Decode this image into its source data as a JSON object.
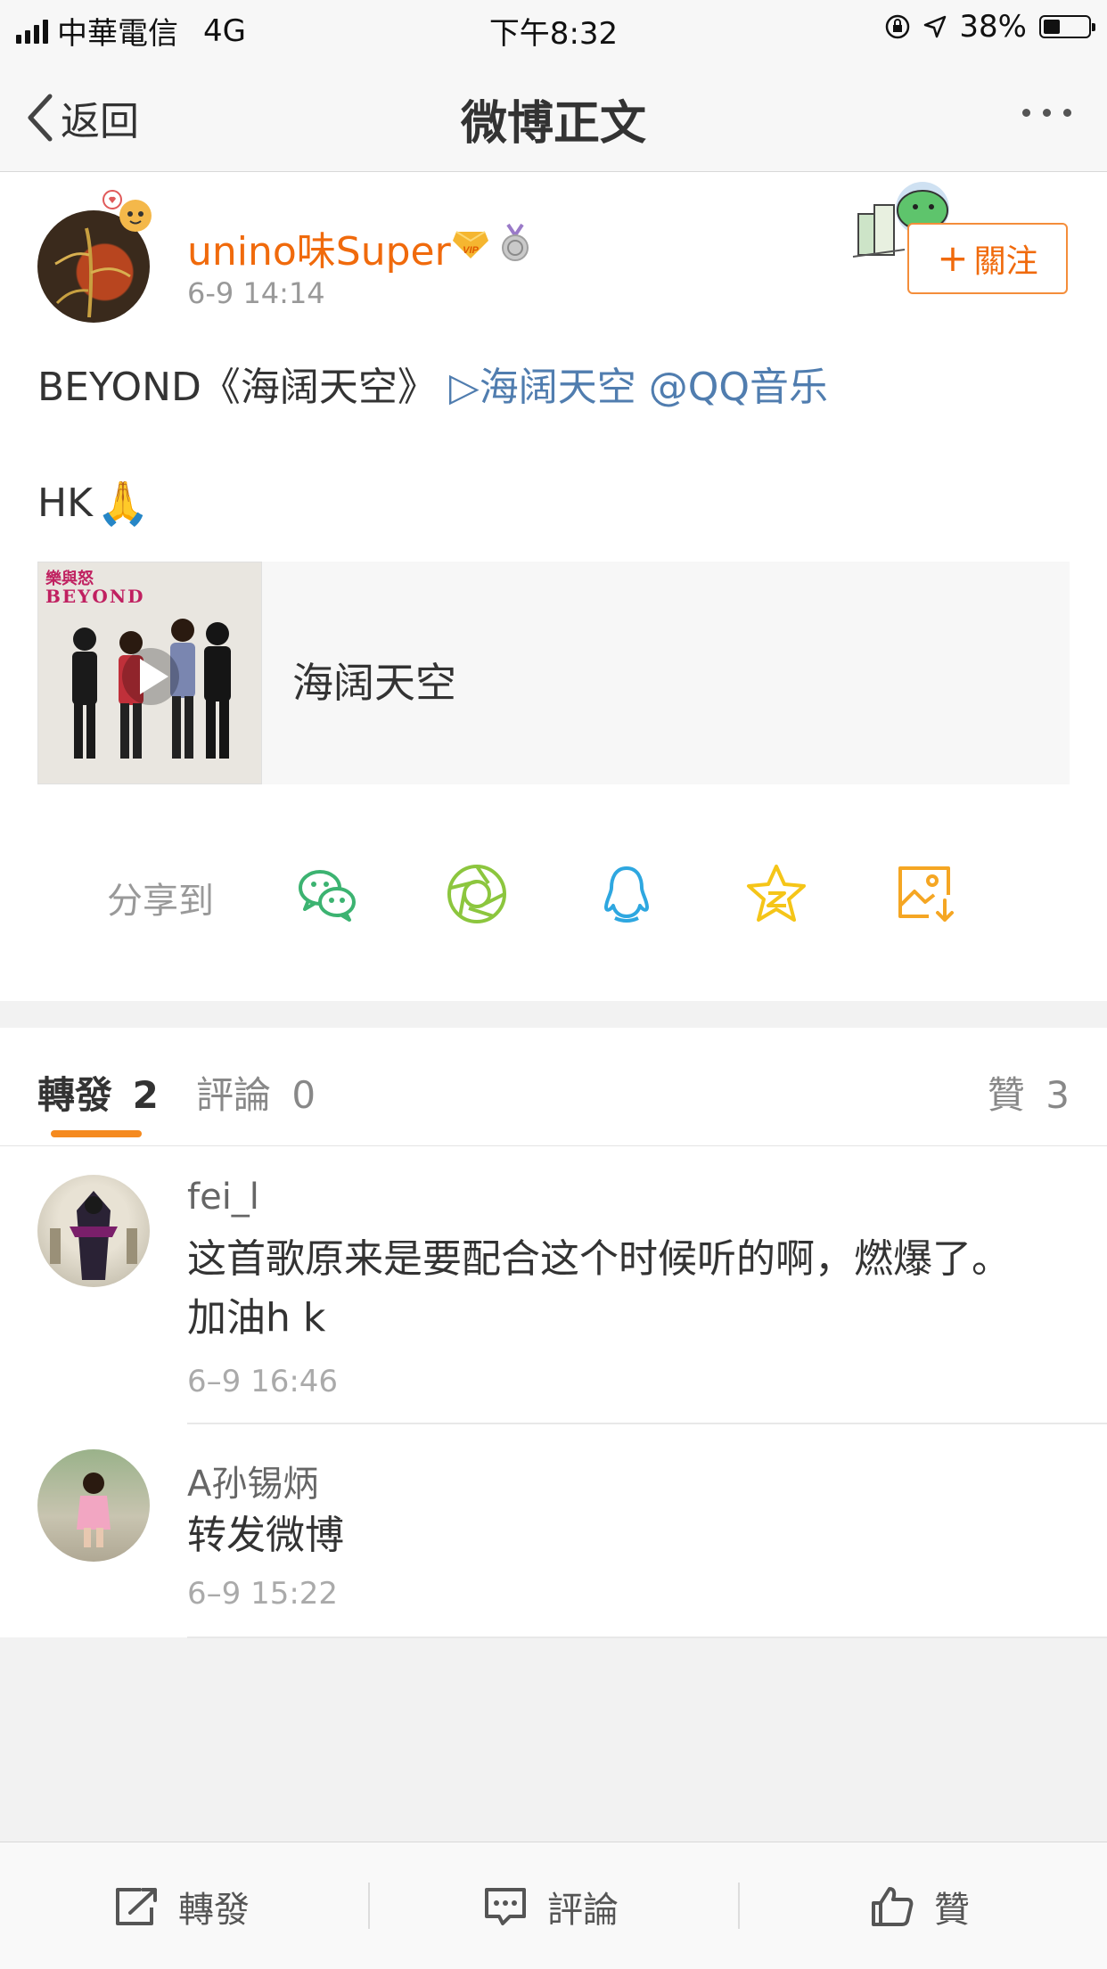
{
  "status_bar": {
    "carrier": "中華電信",
    "network": "4G",
    "time": "下午8:32",
    "battery": "38%"
  },
  "nav": {
    "back_label": "返回",
    "title": "微博正文"
  },
  "post": {
    "username": "unino味Super",
    "time": "6-9 14:14",
    "follow_label": "關注",
    "text_prefix": "BEYOND《海阔天空》 ",
    "text_link": "▷海阔天空 @QQ音乐",
    "text_line2": "HK",
    "emoji": "🙏",
    "music_card": {
      "title": "海阔天空",
      "album_art_text1": "樂與怒",
      "album_art_text2": "BEYOND"
    },
    "share_label": "分享到",
    "share_targets": [
      "wechat-icon",
      "moments-icon",
      "qq-icon",
      "qzone-icon",
      "save-image-icon"
    ]
  },
  "tabs": {
    "repost_label": "轉發",
    "repost_count": "2",
    "comment_label": "評論",
    "comment_count": "0",
    "like_label": "贊",
    "like_count": "3"
  },
  "comments": [
    {
      "name": "fei_l",
      "text_line1": "这首歌原来是要配合这个时候听的啊，燃爆了。",
      "text_line2": "加油h k",
      "time": "6–9 16:46"
    },
    {
      "name": "A孙锡炳",
      "text_line1": "转发微博",
      "time": "6–9 15:22"
    }
  ],
  "toolbar": {
    "repost_label": "轉發",
    "comment_label": "評論",
    "like_label": "贊"
  },
  "colors": {
    "username": "#f06a0c",
    "link": "#507daf",
    "tab_underline": "#f58a1f"
  }
}
